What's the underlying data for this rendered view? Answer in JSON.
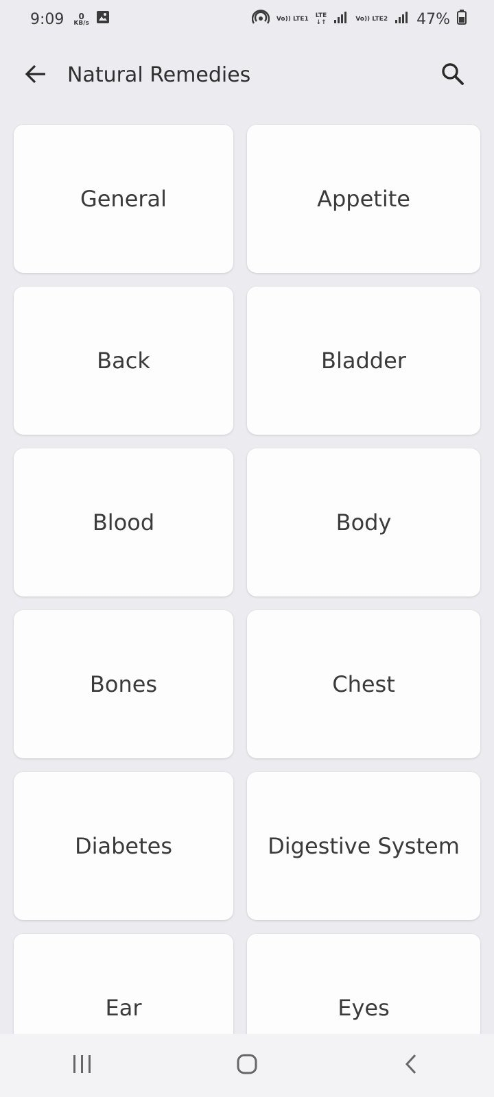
{
  "status_bar": {
    "time": "9:09",
    "data_speed_value": "0",
    "data_speed_unit": "KB/s",
    "volte1": "Vo)) LTE1",
    "lte": "LTE",
    "volte2": "Vo)) LTE2",
    "battery": "47%"
  },
  "app_bar": {
    "title": "Natural Remedies"
  },
  "categories": [
    "General",
    "Appetite",
    "Back",
    "Bladder",
    "Blood",
    "Body",
    "Bones",
    "Chest",
    "Diabetes",
    "Digestive System",
    "Ear",
    "Eyes"
  ],
  "icons": {
    "back": "arrow-left-icon",
    "search": "search-icon",
    "recents": "recents-icon",
    "home": "home-icon",
    "nav_back": "chevron-left-icon"
  }
}
